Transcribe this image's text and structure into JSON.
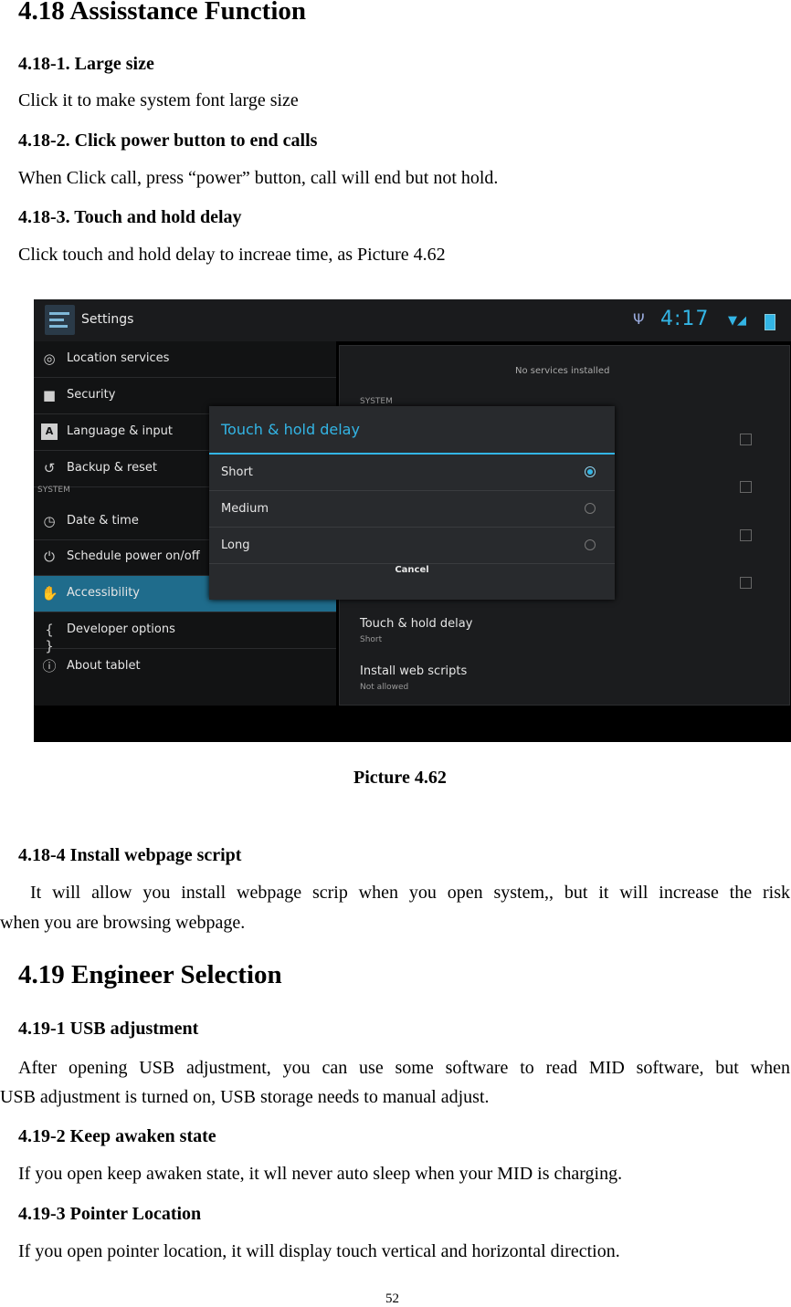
{
  "doc": {
    "heading_418": "4.18 Assisstance Function",
    "s1_title": "4.18-1. Large size",
    "s1_text": "Click it to make system font large size",
    "s2_title": "4.18-2. Click power button to end calls",
    "s2_text": "When Click call, press “power” button, call will end but not hold.",
    "s3_title": "4.18-3. Touch and hold delay",
    "s3_text": "Click touch and hold delay to increae time, as Picture 4.62",
    "caption": "Picture 4.62",
    "s4_title": "4.18-4 Install webpage script",
    "s4_line1": "It will allow you install webpage scrip when you open system,, but it will increase the risk",
    "s4_line2": "when you are browsing webpage.",
    "heading_419": "4.19 Engineer Selection",
    "u1_title": "4.19-1 USB adjustment",
    "u1_line1": "After opening USB adjustment, you can use some software to read MID software, but when",
    "u1_line2": "USB adjustment is turned on, USB storage needs to manual adjust.",
    "u2_title": "4.19-2 Keep awaken state",
    "u2_text": "If you open keep awaken state, it wll never auto sleep when your MID is charging.",
    "u3_title": "4.19-3 Pointer Location",
    "u3_text": "If you open pointer location, it will display touch vertical and horizontal direction.",
    "page_number": "52"
  },
  "screenshot": {
    "app_title": "Settings",
    "clock": "4:17",
    "accent_color": "#33b5e5",
    "left_items": [
      {
        "label": "Location services",
        "icon": "location-icon"
      },
      {
        "label": "Security",
        "icon": "lock-icon"
      },
      {
        "label": "Language & input",
        "icon": "language-icon"
      },
      {
        "label": "Backup & reset",
        "icon": "backup-icon"
      },
      {
        "label": "Date & time",
        "icon": "clock-icon"
      },
      {
        "label": "Schedule power on/off",
        "icon": "power-icon"
      },
      {
        "label": "Accessibility",
        "icon": "hand-icon",
        "selected": true
      },
      {
        "label": "Developer options",
        "icon": "braces-icon"
      },
      {
        "label": "About tablet",
        "icon": "info-icon"
      }
    ],
    "left_section": "SYSTEM",
    "right_empty": "No services installed",
    "right_section": "SYSTEM",
    "right_items": [
      {
        "title": "Touch & hold delay",
        "sub": "Short"
      },
      {
        "title": "Install web scripts",
        "sub": "Not allowed"
      }
    ],
    "dialog": {
      "title": "Touch & hold delay",
      "options": [
        "Short",
        "Medium",
        "Long"
      ],
      "selected": "Short",
      "cancel": "Cancel"
    }
  }
}
